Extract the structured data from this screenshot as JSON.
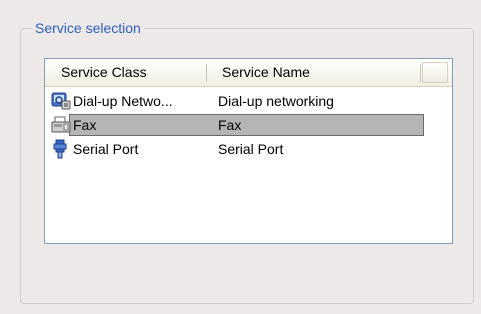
{
  "group": {
    "title": "Service selection"
  },
  "list": {
    "columns": [
      "Service Class",
      "Service Name"
    ],
    "rows": [
      {
        "class": "Dial-up Netwo...",
        "name": "Dial-up networking",
        "icon": "dialup-networking-icon",
        "selected": false
      },
      {
        "class": "Fax",
        "name": "Fax",
        "icon": "fax-icon",
        "selected": true
      },
      {
        "class": "Serial Port",
        "name": "Serial Port",
        "icon": "serial-port-icon",
        "selected": false
      }
    ]
  },
  "colors": {
    "title": "#2e5fbf",
    "selection": "#b5b5b5",
    "list_border": "#7f9db9"
  }
}
